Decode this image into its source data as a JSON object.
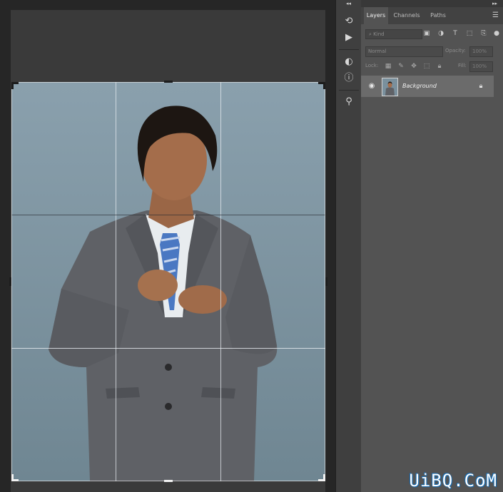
{
  "panel": {
    "tabs": [
      {
        "label": "Layers",
        "active": true
      },
      {
        "label": "Channels",
        "active": false
      },
      {
        "label": "Paths",
        "active": false
      }
    ],
    "filter_placeholder": "Kind",
    "blend_mode": "Normal",
    "opacity_label": "Opacity:",
    "opacity_value": "100%",
    "locks_label": "Lock:",
    "fill_label": "Fill:",
    "fill_value": "100%",
    "layers": [
      {
        "name": "Background",
        "visible": true,
        "locked": true
      }
    ]
  },
  "tool_strip": {
    "icons": [
      "history-icon",
      "play-actions-icon",
      "color-icon",
      "info-icon",
      "clone-source-icon"
    ]
  },
  "watermark": "UiBQ.CoM",
  "colors": {
    "canvas_bg": "#262626",
    "pasteboard": "#3a3a3a",
    "panel_bg": "#535353",
    "selected_layer": "#6b6b6b",
    "photo_bg": "#7a909d"
  }
}
